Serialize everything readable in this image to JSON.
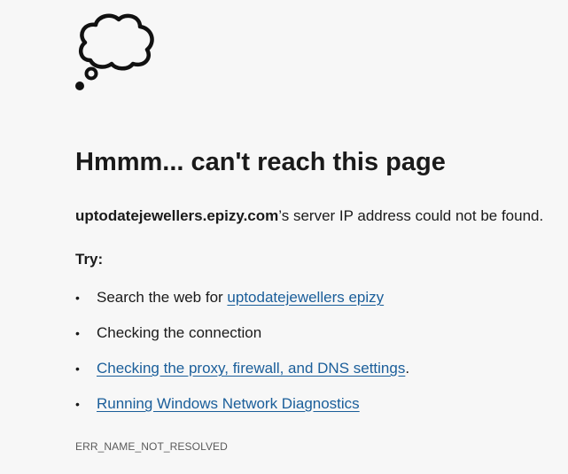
{
  "icon": {
    "name": "thought-cloud-icon"
  },
  "heading": "Hmmm... can't reach this page",
  "message": {
    "host": "uptodatejewellers.epizy.com",
    "suffix": "’s server IP address could not be found."
  },
  "try_label": "Try:",
  "suggestions": [
    {
      "prefix": "Search the web for ",
      "link": "uptodatejewellers epizy",
      "suffix": ""
    },
    {
      "prefix": "Checking the connection",
      "link": "",
      "suffix": ""
    },
    {
      "prefix": "",
      "link": "Checking the proxy, firewall, and DNS settings",
      "suffix": "."
    },
    {
      "prefix": "",
      "link": "Running Windows Network Diagnostics",
      "suffix": ""
    }
  ],
  "bullet": "•",
  "error_code": "ERR_NAME_NOT_RESOLVED",
  "colors": {
    "background": "#f7f7f7",
    "text": "#1a1a1a",
    "link": "#1a5e9a",
    "muted": "#5a5a5a"
  }
}
